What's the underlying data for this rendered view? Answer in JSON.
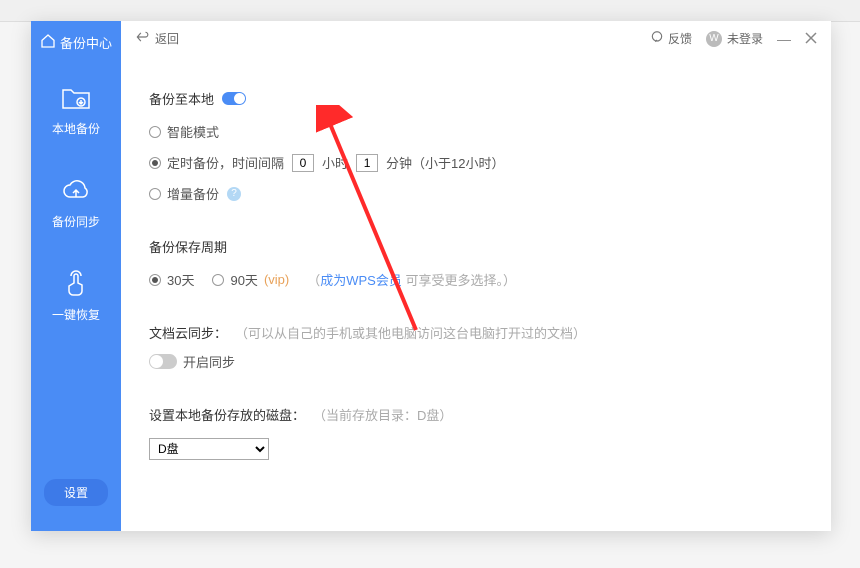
{
  "sidebar": {
    "title": "备份中心",
    "items": [
      {
        "label": "本地备份"
      },
      {
        "label": "备份同步"
      },
      {
        "label": "一键恢复"
      }
    ],
    "settings": "设置"
  },
  "topbar": {
    "back": "返回",
    "feedback": "反馈",
    "user_initial": "W",
    "user_label": "未登录"
  },
  "sections": {
    "backup_local": {
      "title": "备份至本地",
      "mode_smart": "智能模式",
      "mode_timed_prefix": "定时备份，时间间隔",
      "hours_value": "0",
      "hours_label": "小时",
      "minutes_value": "1",
      "minutes_label": "分钟（小于12小时）",
      "mode_incremental": "增量备份"
    },
    "retention": {
      "title": "备份保存周期",
      "opt30": "30天",
      "opt90": "90天",
      "vip": "(vip)",
      "paren_open": "（",
      "link": "成为WPS会员",
      "paren_rest": " 可享受更多选择。）"
    },
    "cloud_sync": {
      "title": "文档云同步：",
      "hint": "（可以从自己的手机或其他电脑访问这台电脑打开过的文档）",
      "enable": "开启同步"
    },
    "disk": {
      "title": "设置本地备份存放的磁盘：",
      "hint": "（当前存放目录：D盘）",
      "value": "D盘"
    }
  }
}
